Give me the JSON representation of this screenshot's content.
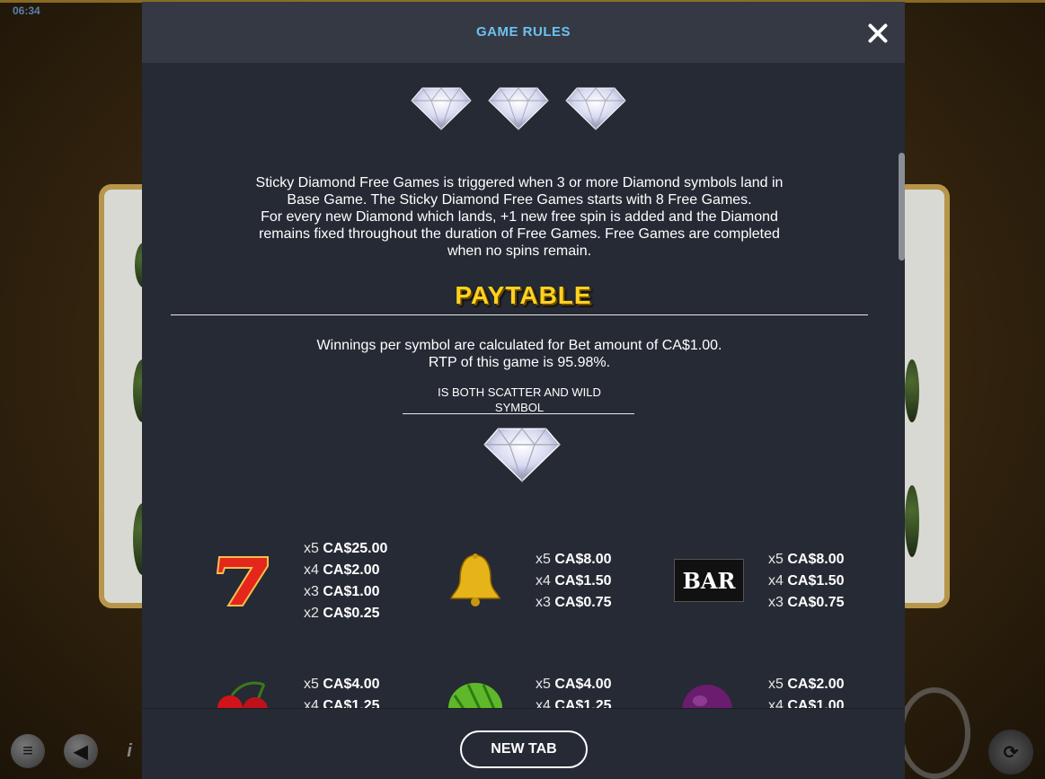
{
  "background": {
    "clock": "06:34"
  },
  "modal": {
    "title": "GAME RULES",
    "close_icon": "close-icon",
    "description_lines": [
      "Sticky Diamond Free Games is triggered when 3 or more Diamond symbols land in",
      "Base Game. The Sticky Diamond Free Games starts with 8 Free Games.",
      "For every new Diamond which lands, +1 new free spin is added and the Diamond",
      "remains fixed throughout the duration of Free Games. Free Games are completed",
      "when no spins remain."
    ],
    "paytable_title": "PAYTABLE",
    "paytable_info": [
      "Winnings per symbol are calculated for Bet amount of CA$1.00.",
      "RTP of this game is 95.98%."
    ],
    "wild_label_lines": [
      "IS BOTH SCATTER AND WILD",
      "SYMBOL"
    ],
    "paytable": [
      {
        "symbol": "seven-icon",
        "pays": [
          {
            "mult": "x5",
            "value": "CA$25.00"
          },
          {
            "mult": "x4",
            "value": "CA$2.00"
          },
          {
            "mult": "x3",
            "value": "CA$1.00"
          },
          {
            "mult": "x2",
            "value": "CA$0.25"
          }
        ]
      },
      {
        "symbol": "bell-icon",
        "pays": [
          {
            "mult": "x5",
            "value": "CA$8.00"
          },
          {
            "mult": "x4",
            "value": "CA$1.50"
          },
          {
            "mult": "x3",
            "value": "CA$0.75"
          }
        ]
      },
      {
        "symbol": "bar-icon",
        "symbol_text": "BAR",
        "pays": [
          {
            "mult": "x5",
            "value": "CA$8.00"
          },
          {
            "mult": "x4",
            "value": "CA$1.50"
          },
          {
            "mult": "x3",
            "value": "CA$0.75"
          }
        ]
      },
      {
        "symbol": "cherry-icon",
        "pays": [
          {
            "mult": "x5",
            "value": "CA$4.00"
          },
          {
            "mult": "x4",
            "value": "CA$1.25"
          }
        ]
      },
      {
        "symbol": "watermelon-icon",
        "pays": [
          {
            "mult": "x5",
            "value": "CA$4.00"
          },
          {
            "mult": "x4",
            "value": "CA$1.25"
          }
        ]
      },
      {
        "symbol": "plum-icon",
        "pays": [
          {
            "mult": "x5",
            "value": "CA$2.00"
          },
          {
            "mult": "x4",
            "value": "CA$1.00"
          }
        ]
      }
    ],
    "footer_button": "NEW TAB"
  },
  "colors": {
    "title": "#6cc2f0",
    "paytable_title": "#ffd21f",
    "modal_bg": "#262a34",
    "header_bg": "#353944"
  }
}
